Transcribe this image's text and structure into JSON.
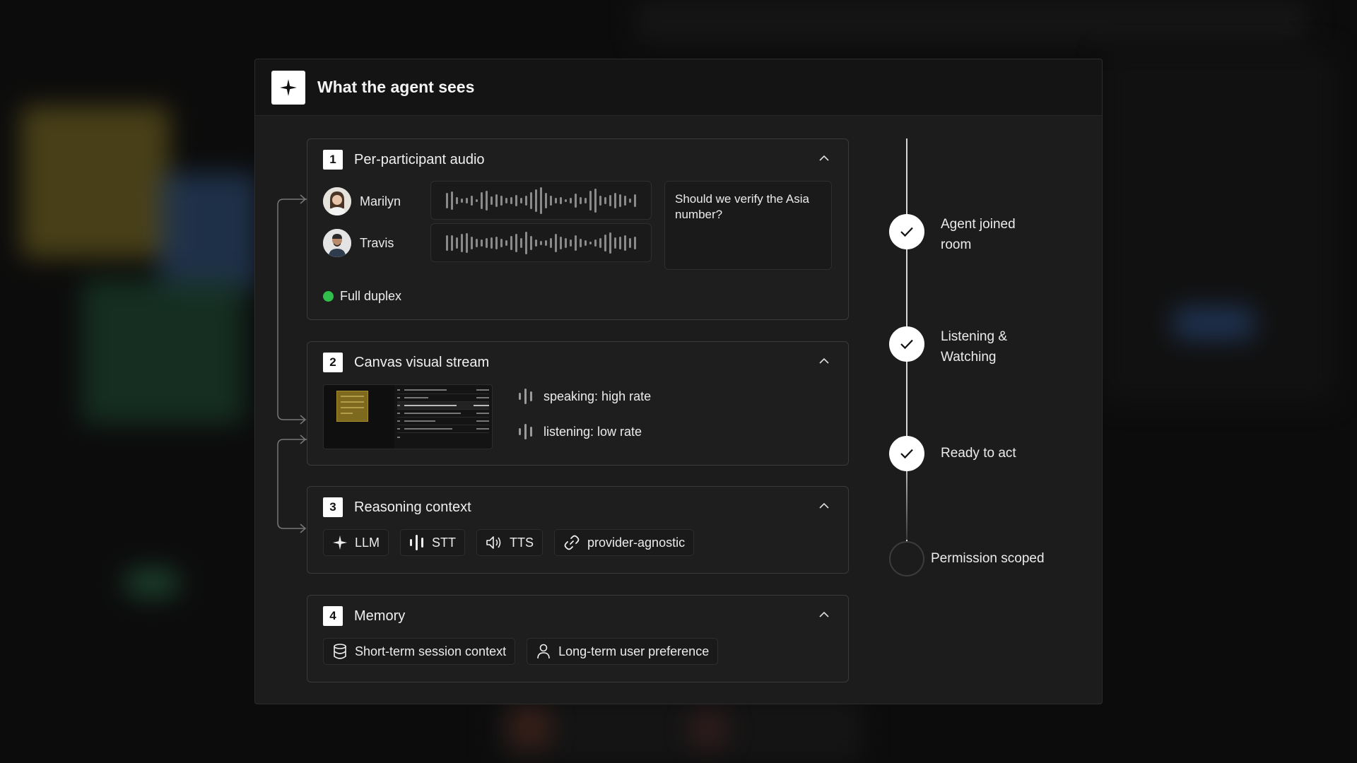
{
  "panel": {
    "title": "What the agent sees",
    "icon": "sparkle-icon"
  },
  "sections": {
    "audio": {
      "number": "1",
      "title": "Per-participant audio",
      "participants": [
        {
          "name": "Marilyn"
        },
        {
          "name": "Travis"
        }
      ],
      "quote": "Should we verify the Asia number?",
      "duplex_label": "Full duplex",
      "duplex_color": "#2fbf4a"
    },
    "canvas": {
      "number": "2",
      "title": "Canvas visual stream",
      "rates": [
        "speaking: high rate",
        "listening: low rate"
      ]
    },
    "reasoning": {
      "number": "3",
      "title": "Reasoning context",
      "chips": [
        {
          "label": "LLM",
          "icon": "sparkle-icon"
        },
        {
          "label": "STT",
          "icon": "waveform-icon"
        },
        {
          "label": "TTS",
          "icon": "speaker-icon"
        },
        {
          "label": "provider-agnostic",
          "icon": "link-icon"
        }
      ]
    },
    "memory": {
      "number": "4",
      "title": "Memory",
      "chips": [
        {
          "label": "Short-term session context",
          "icon": "database-icon"
        },
        {
          "label": "Long-term user preference",
          "icon": "user-icon"
        }
      ]
    }
  },
  "timeline": {
    "steps": [
      {
        "label": "Agent joined room",
        "status": "done"
      },
      {
        "label": "Listening & Watching",
        "status": "done"
      },
      {
        "label": "Ready to act",
        "status": "done"
      },
      {
        "label": "Permission scoped",
        "status": "pending"
      }
    ]
  }
}
